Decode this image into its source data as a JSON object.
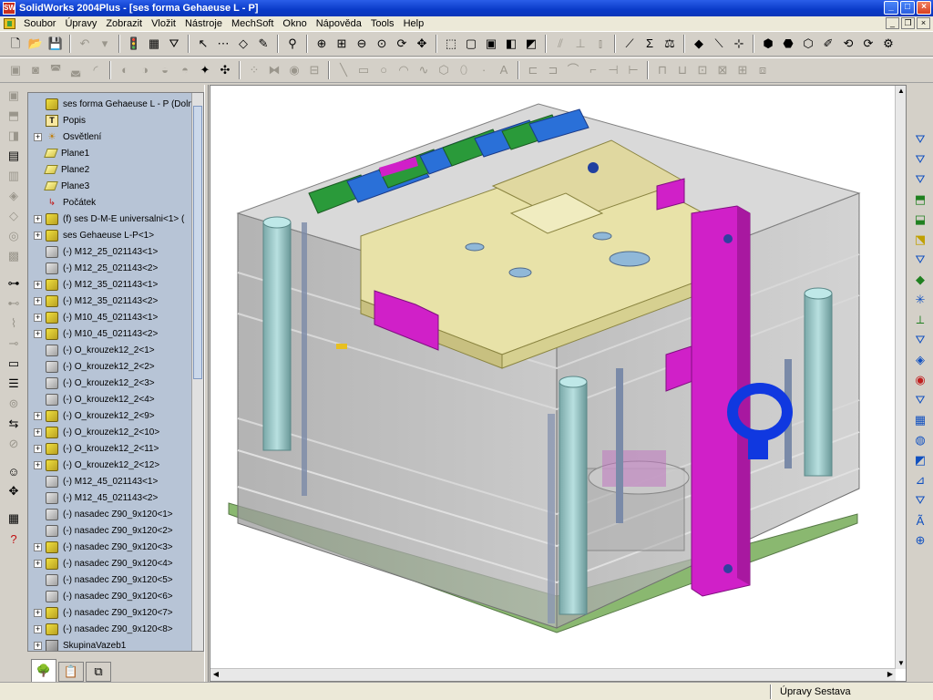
{
  "window": {
    "title": "SolidWorks 2004Plus - [ses forma Gehaeuse L - P]",
    "logo_text": "SW",
    "minimize": "_",
    "maximize": "□",
    "close": "×"
  },
  "menu": {
    "items": [
      "Soubor",
      "Úpravy",
      "Zobrazit",
      "Vložit",
      "Nástroje",
      "MechSoft",
      "Okno",
      "Nápověda",
      "Tools",
      "Help"
    ],
    "doc_minimize": "_",
    "doc_restore": "❐",
    "doc_close": "×"
  },
  "toolbar1": [
    {
      "name": "new-file-icon",
      "glyph": "🗋"
    },
    {
      "name": "open-file-icon",
      "glyph": "📂"
    },
    {
      "name": "save-icon",
      "glyph": "💾"
    },
    {
      "sep": true
    },
    {
      "name": "undo-icon",
      "glyph": "↶",
      "dis": true
    },
    {
      "name": "dropdown-icon",
      "glyph": "▾",
      "dis": true
    },
    {
      "sep": true
    },
    {
      "name": "traffic-light-icon",
      "glyph": "🚦"
    },
    {
      "name": "color-palette-icon",
      "glyph": "▦"
    },
    {
      "name": "filter-icon",
      "glyph": "⛛"
    },
    {
      "sep": true
    },
    {
      "name": "select-arrow-icon",
      "glyph": "↖"
    },
    {
      "name": "grid-icon",
      "glyph": "⋯"
    },
    {
      "name": "eraser-icon",
      "glyph": "◇"
    },
    {
      "name": "sketch-pencil-icon",
      "glyph": "✎"
    },
    {
      "sep": true
    },
    {
      "name": "measure-icon",
      "glyph": "⚲"
    },
    {
      "sep": true
    },
    {
      "name": "zoom-fit-icon",
      "glyph": "⊕"
    },
    {
      "name": "zoom-area-icon",
      "glyph": "⊞"
    },
    {
      "name": "zoom-in-out-icon",
      "glyph": "⊖"
    },
    {
      "name": "zoom-selection-icon",
      "glyph": "⊙"
    },
    {
      "name": "rotate-view-icon",
      "glyph": "⟳"
    },
    {
      "name": "pan-icon",
      "glyph": "✥"
    },
    {
      "sep": true
    },
    {
      "name": "view-orientation-icon",
      "glyph": "⬚"
    },
    {
      "name": "wireframe-icon",
      "glyph": "▢"
    },
    {
      "name": "hidden-lines-icon",
      "glyph": "▣"
    },
    {
      "name": "shaded-edges-icon",
      "glyph": "◧"
    },
    {
      "name": "shaded-icon",
      "glyph": "◩"
    },
    {
      "sep": true
    },
    {
      "name": "mate-parallel-icon",
      "glyph": "⫽",
      "dis": true
    },
    {
      "name": "mate-perpendicular-icon",
      "glyph": "⊥",
      "dis": true
    },
    {
      "name": "mate-coincident-icon",
      "glyph": "⫾",
      "dis": true
    },
    {
      "sep": true
    },
    {
      "name": "smart-dimension-icon",
      "glyph": "⟋"
    },
    {
      "name": "sum-icon",
      "glyph": "Σ"
    },
    {
      "name": "balance-icon",
      "glyph": "⚖"
    },
    {
      "sep": true
    },
    {
      "name": "plane-icon",
      "glyph": "◆"
    },
    {
      "name": "axis-icon",
      "glyph": "⟍"
    },
    {
      "name": "coordinate-icon",
      "glyph": "⊹"
    },
    {
      "sep": true
    },
    {
      "name": "assembly-component-icon",
      "glyph": "⬢"
    },
    {
      "name": "hide-show-icon",
      "glyph": "⬣"
    },
    {
      "name": "explode-icon",
      "glyph": "⬡"
    },
    {
      "name": "interference-icon",
      "glyph": "✐"
    },
    {
      "name": "rebuild-icon",
      "glyph": "⟲"
    },
    {
      "name": "edit-component-icon",
      "glyph": "⟳"
    },
    {
      "name": "smart-fasteners-icon",
      "glyph": "⚙"
    }
  ],
  "toolbar2": [
    {
      "name": "feature-extrude-icon",
      "glyph": "▣",
      "dis": true
    },
    {
      "name": "feature-revolve-icon",
      "glyph": "◙",
      "dis": true
    },
    {
      "name": "feature-sweep-icon",
      "glyph": "◚",
      "dis": true
    },
    {
      "name": "feature-loft-icon",
      "glyph": "◛",
      "dis": true
    },
    {
      "name": "feature-fillet-icon",
      "glyph": "◜",
      "dis": true
    },
    {
      "sep": true
    },
    {
      "name": "feature-chamfer-icon",
      "glyph": "◐",
      "dis": true
    },
    {
      "name": "feature-shell-icon",
      "glyph": "◑",
      "dis": true
    },
    {
      "name": "feature-rib-icon",
      "glyph": "◒",
      "dis": true
    },
    {
      "name": "feature-draft-icon",
      "glyph": "◓",
      "dis": true
    },
    {
      "name": "wizard-icon",
      "glyph": "✦"
    },
    {
      "name": "move-component-icon",
      "glyph": "✣"
    },
    {
      "sep": true
    },
    {
      "name": "pattern-icon",
      "glyph": "⁘",
      "dis": true
    },
    {
      "name": "mirror-icon",
      "glyph": "⧓",
      "dis": true
    },
    {
      "name": "hole-icon",
      "glyph": "◉",
      "dis": true
    },
    {
      "name": "cut-icon",
      "glyph": "⊟",
      "dis": true
    },
    {
      "sep": true
    },
    {
      "name": "sketch-line-icon",
      "glyph": "╲",
      "dis": true
    },
    {
      "name": "sketch-rectangle-icon",
      "glyph": "▭",
      "dis": true
    },
    {
      "name": "sketch-circle-icon",
      "glyph": "○",
      "dis": true
    },
    {
      "name": "sketch-arc-icon",
      "glyph": "◠",
      "dis": true
    },
    {
      "name": "sketch-spline-icon",
      "glyph": "∿",
      "dis": true
    },
    {
      "name": "sketch-polygon-icon",
      "glyph": "⬡",
      "dis": true
    },
    {
      "name": "sketch-ellipse-icon",
      "glyph": "⬯",
      "dis": true
    },
    {
      "name": "sketch-point-icon",
      "glyph": "∙",
      "dis": true
    },
    {
      "name": "sketch-text-icon",
      "glyph": "A",
      "dis": true
    },
    {
      "sep": true
    },
    {
      "name": "sketch-offset-icon",
      "glyph": "⊏",
      "dis": true
    },
    {
      "name": "sketch-trim-icon",
      "glyph": "⊐",
      "dis": true
    },
    {
      "name": "sketch-extend-icon",
      "glyph": "⌒",
      "dis": true
    },
    {
      "name": "sketch-fillet-icon",
      "glyph": "⌐",
      "dis": true
    },
    {
      "name": "sketch-mirror-icon",
      "glyph": "⊣",
      "dis": true
    },
    {
      "name": "sketch-move-icon",
      "glyph": "⊢",
      "dis": true
    },
    {
      "sep": true
    },
    {
      "name": "relation-icon",
      "glyph": "⊓",
      "dis": true
    },
    {
      "name": "dimension-icon",
      "glyph": "⊔",
      "dis": true
    },
    {
      "name": "construction-icon",
      "glyph": "⊡",
      "dis": true
    },
    {
      "name": "display-relations-icon",
      "glyph": "⊠",
      "dis": true
    },
    {
      "name": "modify-sketch-icon",
      "glyph": "⊞",
      "dis": true
    },
    {
      "name": "convert-entities-icon",
      "glyph": "⧈",
      "dis": true
    }
  ],
  "left_icons": [
    {
      "name": "part-feature-icon",
      "glyph": "▣",
      "dis": true
    },
    {
      "name": "extrude-boss-icon",
      "glyph": "⬒",
      "dis": true
    },
    {
      "name": "revolve-boss-icon",
      "glyph": "◨",
      "dis": true
    },
    {
      "name": "assembly-toggle-icon",
      "glyph": "▤"
    },
    {
      "name": "cavity-icon",
      "glyph": "▥",
      "dis": true
    },
    {
      "name": "mold-tool-icon",
      "glyph": "◈",
      "dis": true
    },
    {
      "name": "scale-icon",
      "glyph": "◇",
      "dis": true
    },
    {
      "name": "core-icon",
      "glyph": "◎",
      "dis": true
    },
    {
      "name": "split-line-icon",
      "glyph": "▩",
      "dis": true
    },
    {
      "sep": true
    },
    {
      "name": "bolt-icon",
      "glyph": "⊶"
    },
    {
      "name": "pin-icon",
      "glyph": "⊷",
      "dis": true
    },
    {
      "name": "spring-icon",
      "glyph": "⌇",
      "dis": true
    },
    {
      "name": "ejector-icon",
      "glyph": "⊸",
      "dis": true
    },
    {
      "name": "plate-icon",
      "glyph": "▭"
    },
    {
      "name": "stack-icon",
      "glyph": "☰"
    },
    {
      "name": "ring-icon",
      "glyph": "⊚",
      "dis": true
    },
    {
      "name": "fit-icon",
      "glyph": "⇆"
    },
    {
      "name": "tolerance-icon",
      "glyph": "⊘",
      "dis": true
    },
    {
      "sep": true
    },
    {
      "name": "user-icon",
      "glyph": "☺"
    },
    {
      "name": "drag-icon",
      "glyph": "✥"
    },
    {
      "sep": true
    },
    {
      "name": "properties-icon",
      "glyph": "▦"
    },
    {
      "name": "help-icon",
      "glyph": "?",
      "red": true
    }
  ],
  "tree": {
    "root": "ses forma Gehaeuse L - P  (Dolní)",
    "items": [
      {
        "label": "Popis",
        "icon": "ann",
        "expander": false
      },
      {
        "label": "Osvětlení",
        "icon": "light",
        "expander": true
      },
      {
        "label": "Plane1",
        "icon": "plane",
        "expander": false
      },
      {
        "label": "Plane2",
        "icon": "plane",
        "expander": false
      },
      {
        "label": "Plane3",
        "icon": "plane",
        "expander": false
      },
      {
        "label": "Počátek",
        "icon": "origin",
        "expander": false
      },
      {
        "label": "(f) ses D-M-E universalni<1> (",
        "icon": "part",
        "expander": true
      },
      {
        "label": "ses Gehaeuse L-P<1>",
        "icon": "part",
        "expander": true
      },
      {
        "label": "(-) M12_25_021143<1>",
        "icon": "gray",
        "expander": false
      },
      {
        "label": "(-) M12_25_021143<2>",
        "icon": "gray",
        "expander": false
      },
      {
        "label": "(-) M12_35_021143<1>",
        "icon": "part",
        "expander": true
      },
      {
        "label": "(-) M12_35_021143<2>",
        "icon": "part",
        "expander": true
      },
      {
        "label": "(-) M10_45_021143<1>",
        "icon": "part",
        "expander": true
      },
      {
        "label": "(-) M10_45_021143<2>",
        "icon": "part",
        "expander": true
      },
      {
        "label": "(-) O_krouzek12_2<1>",
        "icon": "gray",
        "expander": false
      },
      {
        "label": "(-) O_krouzek12_2<2>",
        "icon": "gray",
        "expander": false
      },
      {
        "label": "(-) O_krouzek12_2<3>",
        "icon": "gray",
        "expander": false
      },
      {
        "label": "(-) O_krouzek12_2<4>",
        "icon": "gray",
        "expander": false
      },
      {
        "label": "(-) O_krouzek12_2<9>",
        "icon": "part",
        "expander": true
      },
      {
        "label": "(-) O_krouzek12_2<10>",
        "icon": "part",
        "expander": true
      },
      {
        "label": "(-) O_krouzek12_2<11>",
        "icon": "part",
        "expander": true
      },
      {
        "label": "(-) O_krouzek12_2<12>",
        "icon": "part",
        "expander": true
      },
      {
        "label": "(-) M12_45_021143<1>",
        "icon": "gray",
        "expander": false
      },
      {
        "label": "(-) M12_45_021143<2>",
        "icon": "gray",
        "expander": false
      },
      {
        "label": "(-) nasadec Z90_9x120<1>",
        "icon": "gray",
        "expander": false
      },
      {
        "label": "(-) nasadec Z90_9x120<2>",
        "icon": "gray",
        "expander": false
      },
      {
        "label": "(-) nasadec Z90_9x120<3>",
        "icon": "part",
        "expander": true
      },
      {
        "label": "(-) nasadec Z90_9x120<4>",
        "icon": "part",
        "expander": true
      },
      {
        "label": "(-) nasadec Z90_9x120<5>",
        "icon": "gray",
        "expander": false
      },
      {
        "label": "(-) nasadec Z90_9x120<6>",
        "icon": "gray",
        "expander": false
      },
      {
        "label": "(-) nasadec Z90_9x120<7>",
        "icon": "part",
        "expander": true
      },
      {
        "label": "(-) nasadec Z90_9x120<8>",
        "icon": "part",
        "expander": true
      },
      {
        "label": "SkupinaVazeb1",
        "icon": "mates",
        "expander": true
      }
    ]
  },
  "panel_tabs": [
    {
      "name": "feature-manager-tab",
      "glyph": "🌳",
      "active": true
    },
    {
      "name": "property-manager-tab",
      "glyph": "📋",
      "active": false
    },
    {
      "name": "configuration-manager-tab",
      "glyph": "⧉",
      "active": false
    }
  ],
  "right_icons": [
    {
      "name": "mold-filter-icon",
      "glyph": "⛛",
      "color": "#1050c0"
    },
    {
      "name": "mold-filter2-icon",
      "glyph": "⛛",
      "color": "#1050c0"
    },
    {
      "name": "mold-insert-icon",
      "glyph": "⛛",
      "color": "#1050c0"
    },
    {
      "name": "mold-plate-icon",
      "glyph": "⬒",
      "color": "#208020"
    },
    {
      "name": "mold-guide-icon",
      "glyph": "⬓",
      "color": "#208020"
    },
    {
      "name": "mold-ejector-icon",
      "glyph": "⬔",
      "color": "#c0a000"
    },
    {
      "name": "mold-pin-icon",
      "glyph": "⛛",
      "color": "#1050c0"
    },
    {
      "name": "mold-bolt-icon",
      "glyph": "◆",
      "color": "#208020"
    },
    {
      "name": "mold-point-icon",
      "glyph": "✳",
      "color": "#1050c0"
    },
    {
      "name": "mold-axis-icon",
      "glyph": "⟂",
      "color": "#208020"
    },
    {
      "name": "mold-water-icon",
      "glyph": "⛛",
      "color": "#1050c0"
    },
    {
      "name": "mold-cooling-icon",
      "glyph": "◈",
      "color": "#1050c0"
    },
    {
      "name": "mold-sprue-icon",
      "glyph": "◉",
      "color": "#c02020"
    },
    {
      "name": "mold-runner-icon",
      "glyph": "⛛",
      "color": "#1050c0"
    },
    {
      "name": "mold-gate-icon",
      "glyph": "▦",
      "color": "#1050c0"
    },
    {
      "name": "mold-spring-icon",
      "glyph": "◍",
      "color": "#1050c0"
    },
    {
      "name": "mold-section-icon",
      "glyph": "◩",
      "color": "#1050c0"
    },
    {
      "name": "mold-angle-icon",
      "glyph": "⊿",
      "color": "#1050c0"
    },
    {
      "name": "mold-lift-icon",
      "glyph": "⛛",
      "color": "#1050c0"
    },
    {
      "name": "mold-text-icon",
      "glyph": "Ã",
      "color": "#1050c0"
    },
    {
      "name": "mold-globe-icon",
      "glyph": "⊕",
      "color": "#1050c0"
    }
  ],
  "status": {
    "text": "Úpravy Sestava"
  },
  "colors": {
    "titlebar": "#0a3ac8",
    "tree_bg": "#b7c4d6",
    "magenta": "#d020c8",
    "blue": "#1040e0",
    "yellow": "#e8e0a0",
    "green": "#30a040"
  }
}
